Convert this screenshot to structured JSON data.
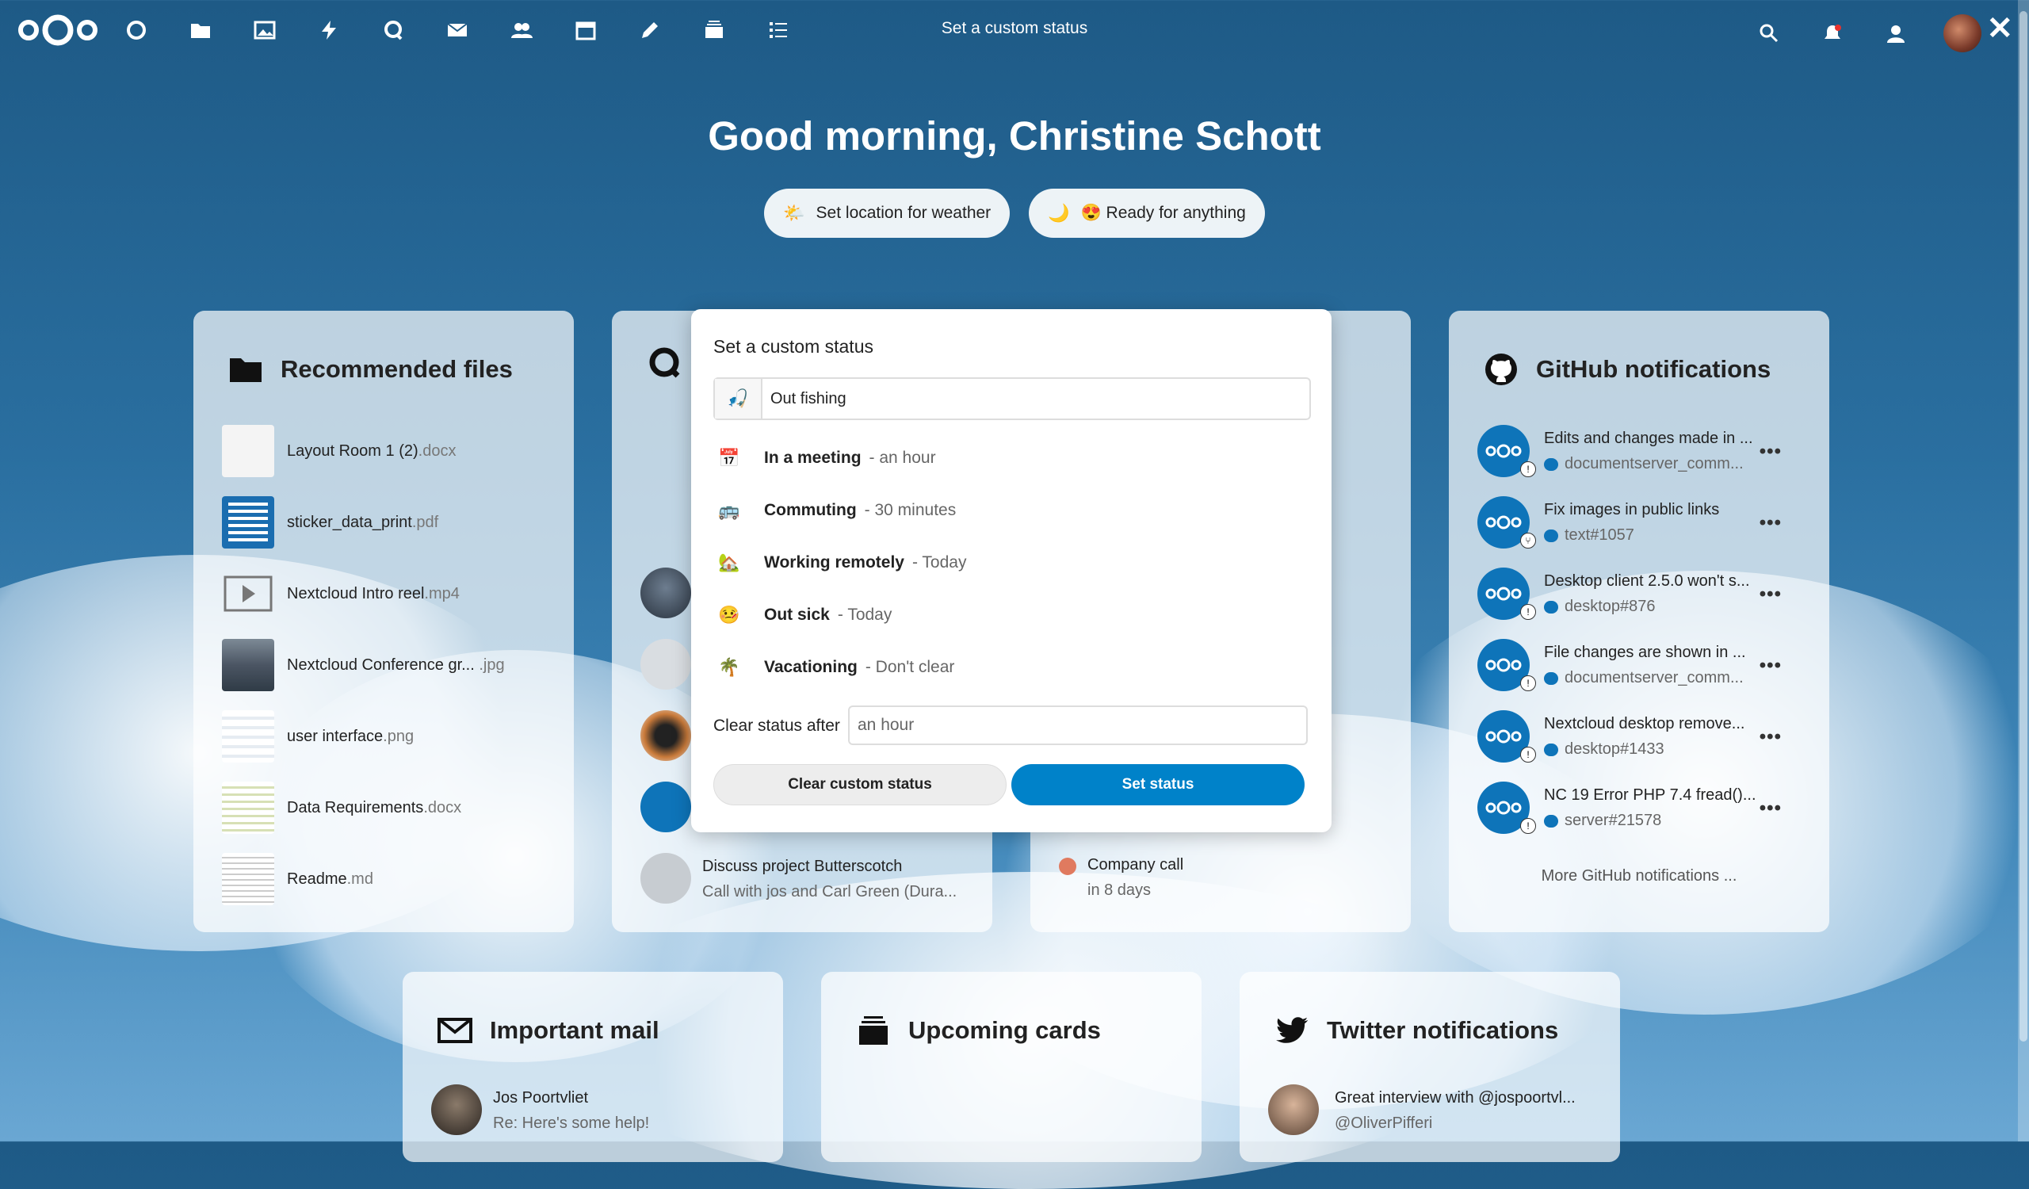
{
  "topbar": {
    "title": "Set a custom status",
    "apps": [
      "dashboard-icon",
      "files-icon",
      "photos-icon",
      "activity-icon",
      "talk-icon",
      "mail-icon",
      "contacts-icon",
      "calendar-icon",
      "notes-icon",
      "deck-icon",
      "tasks-icon"
    ]
  },
  "greeting": "Good morning, Christine Schott",
  "pills": {
    "weather_emoji": "🌤️",
    "weather_label": "Set location for weather",
    "status_emoji": "🌙",
    "status_label": "😍 Ready for anything"
  },
  "recommended": {
    "title": "Recommended files",
    "files": [
      {
        "name": "Layout Room 1 (2)",
        "ext": ".docx"
      },
      {
        "name": "sticker_data_print",
        "ext": ".pdf"
      },
      {
        "name": "Nextcloud Intro reel",
        "ext": ".mp4"
      },
      {
        "name": "Nextcloud Conference gr... ",
        "ext": ".jpg"
      },
      {
        "name": "user interface",
        "ext": ".png"
      },
      {
        "name": "Data Requirements",
        "ext": ".docx"
      },
      {
        "name": "Readme",
        "ext": ".md"
      }
    ]
  },
  "talk": {
    "item_title": "Discuss project Butterscotch",
    "item_sub": "Call with jos and Carl Green (Dura..."
  },
  "calendar": {
    "item_title": "Company call",
    "item_sub": "in 8 days"
  },
  "github": {
    "title": "GitHub notifications",
    "items": [
      {
        "title": "Edits and changes made in ...",
        "sub": "documentserver_comm..."
      },
      {
        "title": "Fix images in public links",
        "sub": "text#1057"
      },
      {
        "title": "Desktop client 2.5.0 won't s...",
        "sub": "desktop#876"
      },
      {
        "title": "File changes are shown in ...",
        "sub": "documentserver_comm..."
      },
      {
        "title": "Nextcloud desktop remove...",
        "sub": "desktop#1433"
      },
      {
        "title": "NC 19 Error PHP 7.4 fread()...",
        "sub": "server#21578"
      }
    ],
    "more": "More GitHub notifications ..."
  },
  "mail": {
    "title": "Important mail",
    "from": "Jos Poortvliet",
    "subject": "Re: Here's some help!"
  },
  "cards": {
    "title": "Upcoming cards"
  },
  "twitter": {
    "title": "Twitter notifications",
    "text": "Great interview with @jospoortvl...",
    "handle": "@OliverPifferi"
  },
  "modal": {
    "title": "Set a custom status",
    "input_emoji": "🎣",
    "input_value": "Out fishing",
    "presets": [
      {
        "emoji": "📅",
        "message": "In a meeting",
        "clear": "- an hour"
      },
      {
        "emoji": "🚌",
        "message": "Commuting",
        "clear": "- 30 minutes"
      },
      {
        "emoji": "🏡",
        "message": "Working remotely",
        "clear": "- Today"
      },
      {
        "emoji": "🤒",
        "message": "Out sick",
        "clear": "- Today"
      },
      {
        "emoji": "🌴",
        "message": "Vacationing",
        "clear": "- Don't clear"
      }
    ],
    "clear_after_label": "Clear status after",
    "clear_after_value": "an hour",
    "clear_button": "Clear custom status",
    "set_button": "Set status"
  },
  "colors": {
    "primary": "#0082c9",
    "background": "#1e5a86"
  }
}
